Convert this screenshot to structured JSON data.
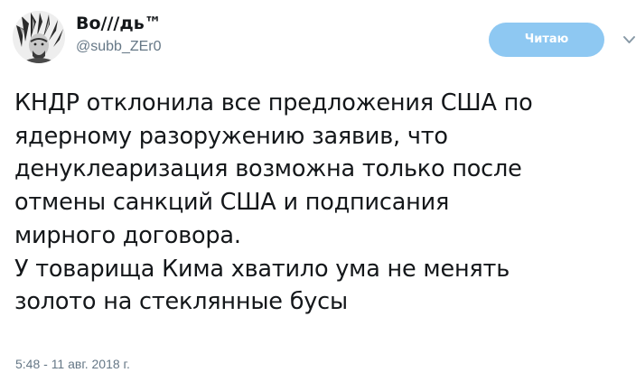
{
  "user": {
    "display_name": "Bo///дь™",
    "handle": "@subb_ZEr0",
    "avatar_icon": "avatar-image"
  },
  "follow_button": {
    "label": "Читаю",
    "color": "#8ec8f2"
  },
  "menu": {
    "icon": "chevron-down-icon"
  },
  "tweet": {
    "text": "КНДР отклонила все предложения США по\nядерному разоружению заявив, что\nденуклеаризация возможна только после\nотмены санкций США и подписания\nмирного договора.\nУ товарища Кима хватило ума не менять\nзолото на стеклянные бусы",
    "timestamp": "5:48 - 11 авг. 2018 г."
  },
  "colors": {
    "text": "#14171a",
    "secondary": "#657786",
    "button": "#8ec8f2"
  }
}
